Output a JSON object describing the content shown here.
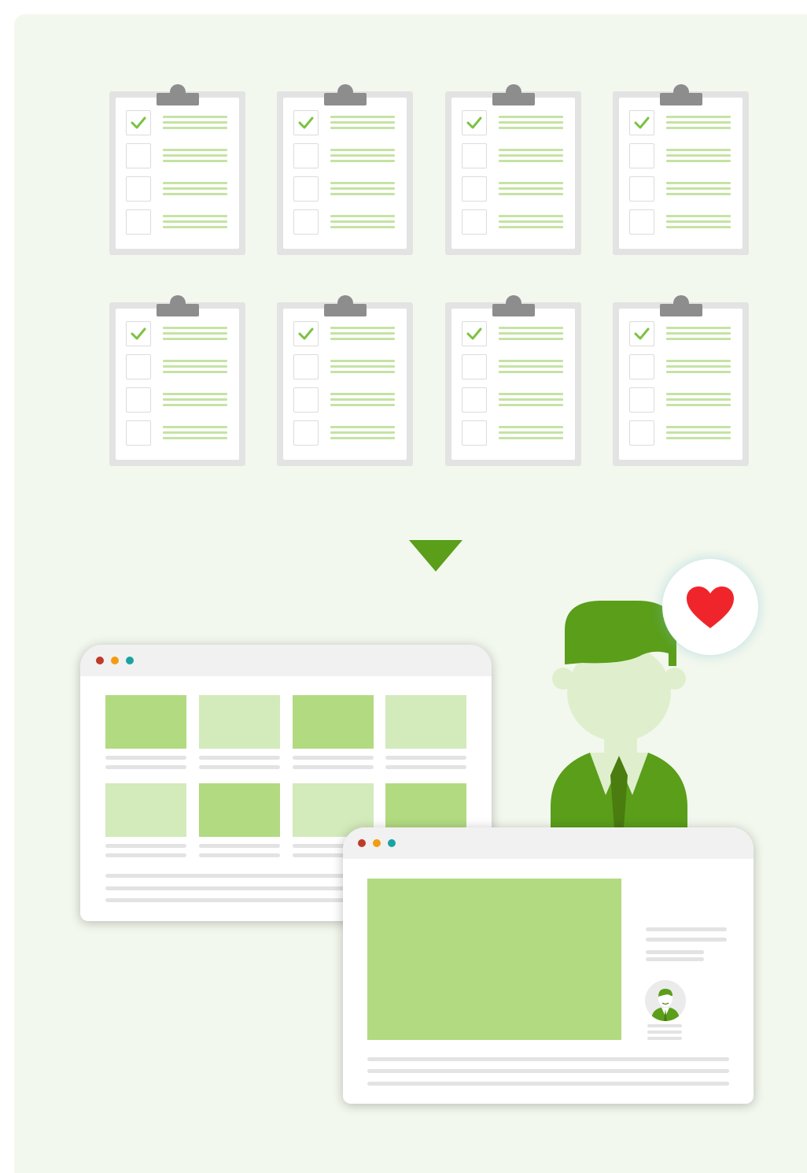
{
  "scene": {
    "colors": {
      "background": "#f3f8ee",
      "accent_green": "#5a9e1a",
      "dark_green": "#4a7c10",
      "light_green": "#b2da80",
      "pale_green": "#d3eabb",
      "skin": "#dfefcd",
      "heart_red": "#f0252b",
      "dot_red": "#c0392b",
      "dot_orange": "#f39c12",
      "dot_teal": "#1aa3a3"
    },
    "clipboards": [
      {
        "checked": [
          true,
          false,
          false,
          false
        ]
      },
      {
        "checked": [
          true,
          false,
          false,
          false
        ]
      },
      {
        "checked": [
          true,
          false,
          false,
          false
        ]
      },
      {
        "checked": [
          true,
          false,
          false,
          false
        ]
      },
      {
        "checked": [
          true,
          false,
          false,
          false
        ]
      },
      {
        "checked": [
          true,
          false,
          false,
          false
        ]
      },
      {
        "checked": [
          true,
          false,
          false,
          false
        ]
      },
      {
        "checked": [
          true,
          false,
          false,
          false
        ]
      }
    ],
    "icons": [
      "clipboard-icon",
      "checkmark-icon",
      "down-arrow-icon",
      "heart-icon",
      "person-icon",
      "avatar-icon"
    ],
    "grid_window": {
      "thumbnail_shades": [
        "light_green",
        "pale_green",
        "light_green",
        "pale_green",
        "pale_green",
        "light_green",
        "pale_green",
        "light_green"
      ]
    },
    "detail_window": {
      "hero_shade": "light_green"
    }
  }
}
